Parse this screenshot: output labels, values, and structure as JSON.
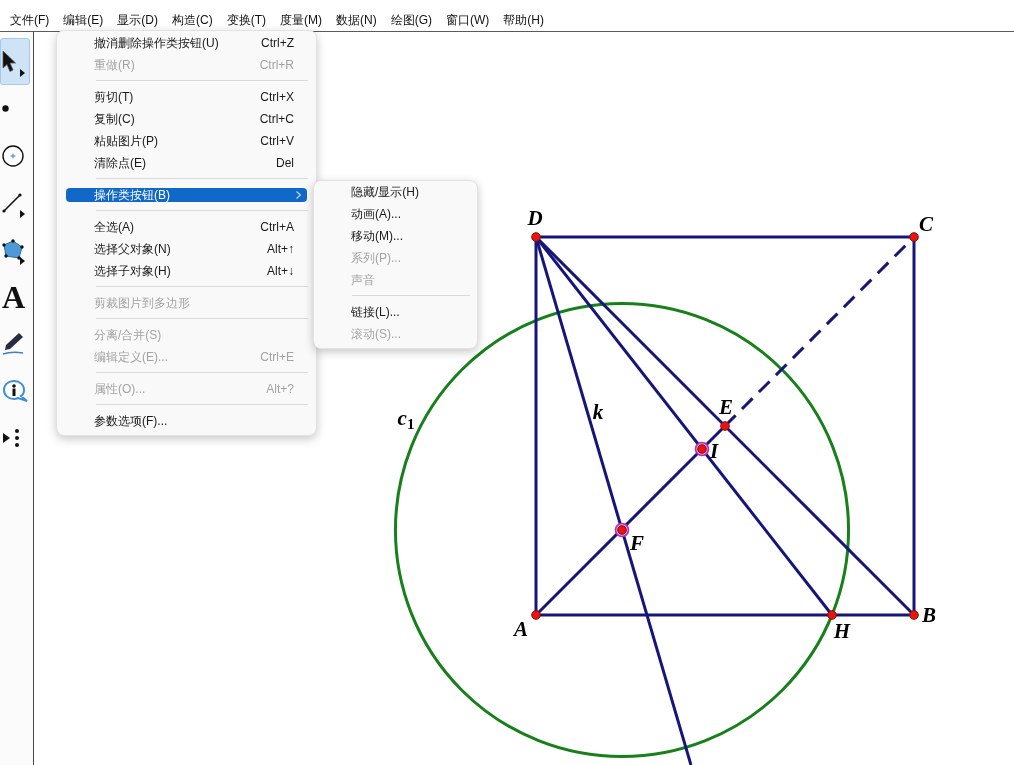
{
  "menu_bar": [
    "文件(F)",
    "编辑(E)",
    "显示(D)",
    "构造(C)",
    "变换(T)",
    "度量(M)",
    "数据(N)",
    "绘图(G)",
    "窗口(W)",
    "帮助(H)"
  ],
  "toolbar": {
    "tools": [
      {
        "selected": true,
        "expandable": true
      },
      {
        "selected": false,
        "expandable": false
      },
      {
        "selected": false,
        "expandable": false
      },
      {
        "selected": false,
        "expandable": true
      },
      {
        "selected": false,
        "expandable": true
      },
      {
        "selected": false,
        "expandable": false,
        "glyph": "A"
      },
      {
        "selected": false,
        "expandable": false
      },
      {
        "selected": false,
        "expandable": false
      },
      {
        "selected": false,
        "expandable": false
      }
    ]
  },
  "edit_menu": {
    "items": [
      {
        "kind": "item",
        "label": "撤消删除操作类按钮(U)",
        "shortcut": "Ctrl+Z",
        "disabled": false,
        "selected": false,
        "submenu": false
      },
      {
        "kind": "item",
        "label": "重做(R)",
        "shortcut": "Ctrl+R",
        "disabled": true,
        "selected": false,
        "submenu": false
      },
      {
        "kind": "separator"
      },
      {
        "kind": "item",
        "label": "剪切(T)",
        "shortcut": "Ctrl+X",
        "disabled": false,
        "selected": false,
        "submenu": false
      },
      {
        "kind": "item",
        "label": "复制(C)",
        "shortcut": "Ctrl+C",
        "disabled": false,
        "selected": false,
        "submenu": false
      },
      {
        "kind": "item",
        "label": "粘贴图片(P)",
        "shortcut": "Ctrl+V",
        "disabled": false,
        "selected": false,
        "submenu": false
      },
      {
        "kind": "item",
        "label": "清除点(E)",
        "shortcut": "Del",
        "disabled": false,
        "selected": false,
        "submenu": false
      },
      {
        "kind": "separator"
      },
      {
        "kind": "item",
        "label": "操作类按钮(B)",
        "disabled": false,
        "selected": true,
        "submenu": true
      },
      {
        "kind": "separator"
      },
      {
        "kind": "item",
        "label": "全选(A)",
        "shortcut": "Ctrl+A",
        "disabled": false,
        "selected": false,
        "submenu": false
      },
      {
        "kind": "item",
        "label": "选择父对象(N)",
        "shortcut": "Alt+↑",
        "disabled": false,
        "selected": false,
        "submenu": false
      },
      {
        "kind": "item",
        "label": "选择子对象(H)",
        "shortcut": "Alt+↓",
        "disabled": false,
        "selected": false,
        "submenu": false
      },
      {
        "kind": "separator"
      },
      {
        "kind": "item",
        "label": "剪裁图片到多边形",
        "disabled": true,
        "selected": false,
        "submenu": false
      },
      {
        "kind": "separator"
      },
      {
        "kind": "item",
        "label": "分离/合并(S)",
        "disabled": true,
        "selected": false,
        "submenu": false
      },
      {
        "kind": "item",
        "label": "编辑定义(E)...",
        "shortcut": "Ctrl+E",
        "disabled": true,
        "selected": false,
        "submenu": false
      },
      {
        "kind": "separator"
      },
      {
        "kind": "item",
        "label": "属性(O)...",
        "shortcut": "Alt+?",
        "disabled": true,
        "selected": false,
        "submenu": false
      },
      {
        "kind": "separator"
      },
      {
        "kind": "item",
        "label": "参数选项(F)...",
        "disabled": false,
        "selected": false,
        "submenu": false
      }
    ]
  },
  "submenu": {
    "items": [
      {
        "kind": "item",
        "label": "隐藏/显示(H)",
        "disabled": false,
        "selected": false
      },
      {
        "kind": "item",
        "label": "动画(A)...",
        "disabled": false,
        "selected": false
      },
      {
        "kind": "item",
        "label": "移动(M)...",
        "disabled": false,
        "selected": false
      },
      {
        "kind": "item",
        "label": "系列(P)...",
        "disabled": true,
        "selected": false
      },
      {
        "kind": "item",
        "label": "声音",
        "disabled": true,
        "selected": false
      },
      {
        "kind": "separator"
      },
      {
        "kind": "item",
        "label": "链接(L)...",
        "disabled": false,
        "selected": false
      },
      {
        "kind": "item",
        "label": "滚动(S)...",
        "disabled": true,
        "selected": false
      }
    ]
  },
  "canvas": {
    "points": [
      {
        "label": "D",
        "selected": false
      },
      {
        "label": "C",
        "selected": false
      },
      {
        "label": "E",
        "selected": false
      },
      {
        "label": "I",
        "selected": true
      },
      {
        "label": "F",
        "selected": true
      },
      {
        "label": "A",
        "selected": false
      },
      {
        "label": "H",
        "selected": false
      },
      {
        "label": "B",
        "selected": false
      }
    ],
    "line_label": "k",
    "circle_label": "c$_{1}$"
  }
}
